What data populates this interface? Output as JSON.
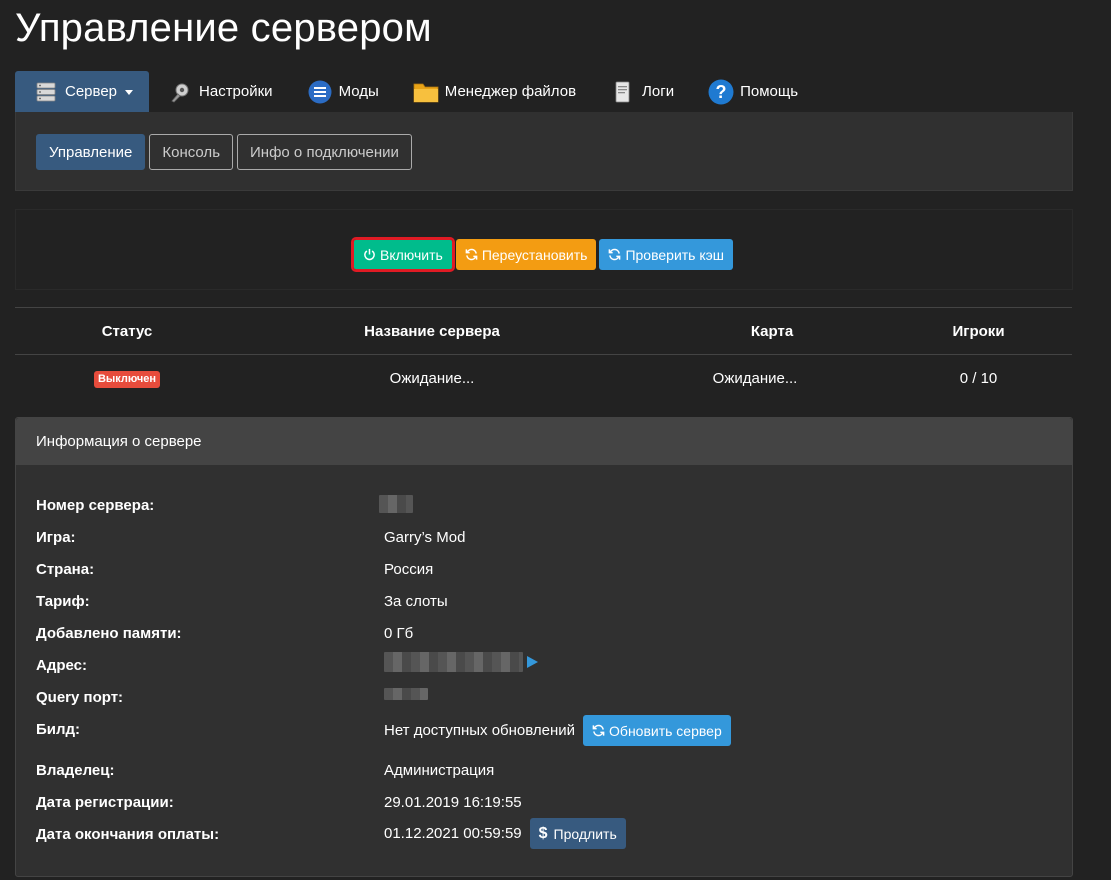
{
  "page": {
    "title": "Управление сервером"
  },
  "nav": {
    "items": [
      {
        "label": "Сервер",
        "icon": "server-icon",
        "active": true
      },
      {
        "label": "Настройки",
        "icon": "settings-gear-icon"
      },
      {
        "label": "Моды",
        "icon": "mods-list-icon"
      },
      {
        "label": "Менеджер файлов",
        "icon": "folder-icon"
      },
      {
        "label": "Логи",
        "icon": "log-document-icon"
      },
      {
        "label": "Помощь",
        "icon": "help-question-icon"
      }
    ]
  },
  "sub_tabs": [
    {
      "label": "Управление",
      "active": true
    },
    {
      "label": "Консоль"
    },
    {
      "label": "Инфо о подключении"
    }
  ],
  "actions": {
    "start": "Включить",
    "reinstall": "Переустановить",
    "verify_cache": "Проверить кэш"
  },
  "status_table": {
    "headers": [
      "Статус",
      "Название сервера",
      "Карта",
      "Игроки"
    ],
    "row": {
      "status": "Выключен",
      "server_name": "Ожидание...",
      "map": "Ожидание...",
      "players": "0 / 10"
    }
  },
  "info": {
    "title": "Информация о сервере",
    "rows": [
      {
        "label": "Номер сервера:",
        "value": ""
      },
      {
        "label": "Игра:",
        "value": "Garry’s Mod"
      },
      {
        "label": "Страна:",
        "value": "Россия"
      },
      {
        "label": "Тариф:",
        "value": "За слоты"
      },
      {
        "label": "Добавлено памяти:",
        "value": "0 Гб"
      },
      {
        "label": "Адрес:",
        "value": ""
      },
      {
        "label": "Query порт:",
        "value": ""
      },
      {
        "label": "Билд:",
        "value": "Нет доступных обновлений"
      },
      {
        "label": "Владелец:",
        "value": "Администрация"
      },
      {
        "label": "Дата регистрации:",
        "value": "29.01.2019 16:19:55"
      },
      {
        "label": "Дата окончания оплаты:",
        "value": "01.12.2021 00:59:59"
      }
    ],
    "update_button": "Обновить сервер",
    "extend_button": "Продлить"
  },
  "colors": {
    "background": "#222222",
    "primary": "#375a7f",
    "success": "#00bc8c",
    "warning": "#f39c12",
    "info": "#3498db",
    "danger": "#e74c3c"
  }
}
